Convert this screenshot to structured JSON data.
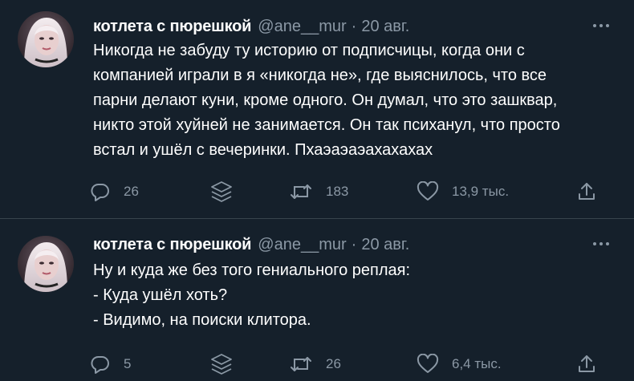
{
  "colors": {
    "background": "#15202b",
    "divider": "#38444d",
    "text_primary": "#ffffff",
    "text_secondary": "#8b98a5"
  },
  "tweets": [
    {
      "author_name": "котлета с пюрешкой",
      "handle": "@ane__mur",
      "separator": "·",
      "date": "20 авг.",
      "text_lines": [
        "Никогда не забуду ту историю от подписчицы, когда они с",
        "компанией играли в я «никогда не», где выяснилось, что все",
        "парни делают куни, кроме одного. Он думал, что это зашквар,",
        "никто этой хуйней не занимается. Он так психанул, что просто",
        "встал и ушёл с вечеринки. Пхаэаэаэахахахах"
      ],
      "reply_count": "26",
      "retweet_count": "183",
      "like_count": "13,9 тыс.",
      "icons": [
        "avatar",
        "more-icon",
        "reply-icon",
        "buffer-icon",
        "retweet-icon",
        "like-icon",
        "share-icon"
      ]
    },
    {
      "author_name": "котлета с пюрешкой",
      "handle": "@ane__mur",
      "separator": "·",
      "date": "20 авг.",
      "text_lines": [
        "Ну и куда же без того гениального реплая:",
        "- Куда ушёл хоть?",
        "- Видимо, на поиски клитора."
      ],
      "reply_count": "5",
      "retweet_count": "26",
      "like_count": "6,4 тыс.",
      "icons": [
        "avatar",
        "more-icon",
        "reply-icon",
        "buffer-icon",
        "retweet-icon",
        "like-icon",
        "share-icon"
      ]
    }
  ]
}
